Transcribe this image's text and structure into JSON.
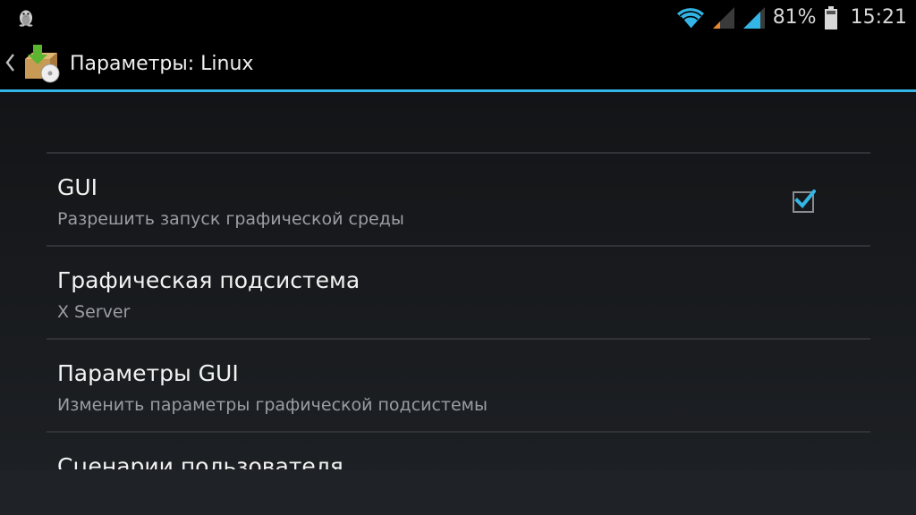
{
  "status_bar": {
    "left_icon": "linux-penguin-icon",
    "battery": "81%",
    "time": "15:21",
    "icons": [
      "wifi-icon",
      "signal-weak-icon",
      "signal-strong-icon",
      "battery-icon"
    ],
    "accent_color": "#33b5e5"
  },
  "action_bar": {
    "back_icon": "chevron-left-icon",
    "app_icon": "package-install-icon",
    "title": "Параметры: Linux"
  },
  "settings": {
    "items": [
      {
        "title": "GUI",
        "summary": "Разрешить запуск графической среды",
        "checked": true
      },
      {
        "title": "Графическая подсистема",
        "summary": "X Server"
      },
      {
        "title": "Параметры GUI",
        "summary": "Изменить параметры графической подсистемы"
      },
      {
        "title": "Сценарии пользователя",
        "summary": "",
        "checked": false
      }
    ]
  },
  "colors": {
    "accent": "#33b5e5",
    "title_text": "#f2f2f2",
    "summary_text": "#9a9da2",
    "divider": "#2f3236"
  }
}
